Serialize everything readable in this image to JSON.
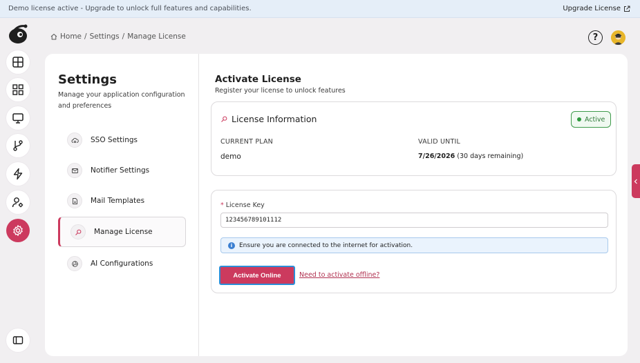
{
  "banner": {
    "message": "Demo license active - Upgrade to unlock full features and capabilities.",
    "upgrade_label": "Upgrade License"
  },
  "breadcrumb": {
    "home": "Home",
    "settings": "Settings",
    "current": "Manage License",
    "separator": "/"
  },
  "header": {
    "help_glyph": "?"
  },
  "rail": {
    "items": [
      "tables-icon",
      "dashboard-grid-icon",
      "monitor-icon",
      "git-branch-icon",
      "lightning-icon",
      "user-settings-icon",
      "gear-icon"
    ],
    "active": "gear-icon",
    "footer_icon": "sidebar-toggle-icon"
  },
  "settings": {
    "title": "Settings",
    "subtitle": "Manage your application configuration and preferences",
    "nav": [
      {
        "label": "SSO Settings",
        "icon": "cloud-lock-icon"
      },
      {
        "label": "Notifier Settings",
        "icon": "mail-icon"
      },
      {
        "label": "Mail Templates",
        "icon": "document-icon"
      },
      {
        "label": "Manage License",
        "icon": "key-search-icon",
        "active": true
      },
      {
        "label": "AI Configurations",
        "icon": "ai-aperture-icon"
      }
    ]
  },
  "license": {
    "title": "Activate License",
    "subtitle": "Register your license to unlock features",
    "info_title": "License Information",
    "status": "Active",
    "current_plan_label": "CURRENT PLAN",
    "current_plan_value": "demo",
    "valid_until_label": "VALID UNTIL",
    "valid_until_date": "7/26/2026",
    "valid_until_note": "(30 days remaining)",
    "key_label": "License Key",
    "key_required_mark": "*",
    "key_value": "123456789101112",
    "notice": "Ensure you are connected to the internet for activation.",
    "activate_button": "Activate Online",
    "offline_link": "Need to activate offline?"
  },
  "colors": {
    "brand": "#cc3a5e",
    "success": "#2e9a3e",
    "info": "#3b7fd1",
    "banner_bg": "#e5eef8"
  }
}
